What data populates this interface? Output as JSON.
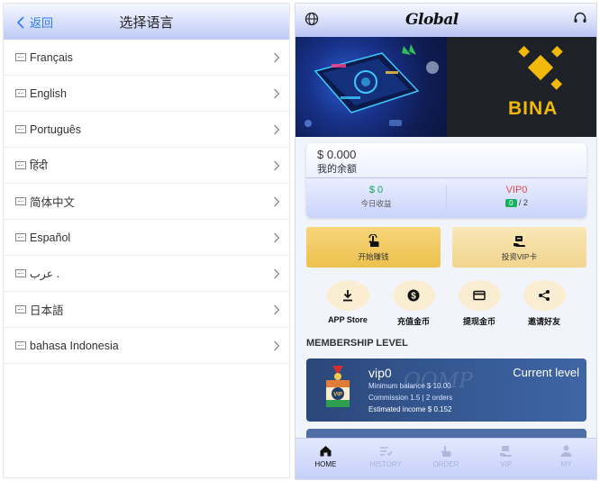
{
  "language_page": {
    "back_label": "返回",
    "title": "选择语言",
    "languages": [
      "Français",
      "English",
      "Português",
      "हिंदी",
      "简体中文",
      "Español",
      "عرب .",
      "日本語",
      "bahasa Indonesia"
    ]
  },
  "home_page": {
    "header": {
      "logo_text": "Global",
      "globe_icon": "globe-icon",
      "service_icon": "headset-icon"
    },
    "banner": {
      "right_text": "BINA"
    },
    "balance": {
      "amount": "$ 0.000",
      "label": "我的余额",
      "today_value": "$ 0",
      "today_label": "今日收益",
      "vip_level": "VIP0",
      "vip_progress_current": "0",
      "vip_progress_sep": "/ 2"
    },
    "actions": [
      {
        "label": "开始赚钱",
        "icon": "hand-pointer-icon"
      },
      {
        "label": "投资VIP卡",
        "icon": "vip-card-icon"
      }
    ],
    "quick_links": [
      {
        "label": "APP Store",
        "icon": "download-icon"
      },
      {
        "label": "充值金币",
        "icon": "dollar-coin-icon"
      },
      {
        "label": "提现金币",
        "icon": "card-icon"
      },
      {
        "label": "邀请好友",
        "icon": "share-icon"
      }
    ],
    "membership": {
      "title": "MEMBERSHIP LEVEL",
      "level_name": "vip0",
      "current_label": "Current level",
      "minimum_balance": "Minimum balance $ 10.00",
      "commission": "Commission 1.5 | 2 orders",
      "estimated_income": "Estimated income $ 0.152",
      "watermark": "OOMP"
    },
    "bottom_nav": [
      {
        "label": "HOME",
        "icon": "home-icon",
        "active": true
      },
      {
        "label": "HISTORY",
        "icon": "history-icon",
        "active": false
      },
      {
        "label": "ORDER",
        "icon": "order-icon",
        "active": false
      },
      {
        "label": "VIP",
        "icon": "vip-icon",
        "active": false
      },
      {
        "label": "MY",
        "icon": "user-icon",
        "active": false
      }
    ]
  },
  "colors": {
    "link_blue": "#2b7cf5",
    "gold": "#f0b90b",
    "green": "#19a35b",
    "red": "#e34a4a",
    "vip_card": "#33558e"
  }
}
